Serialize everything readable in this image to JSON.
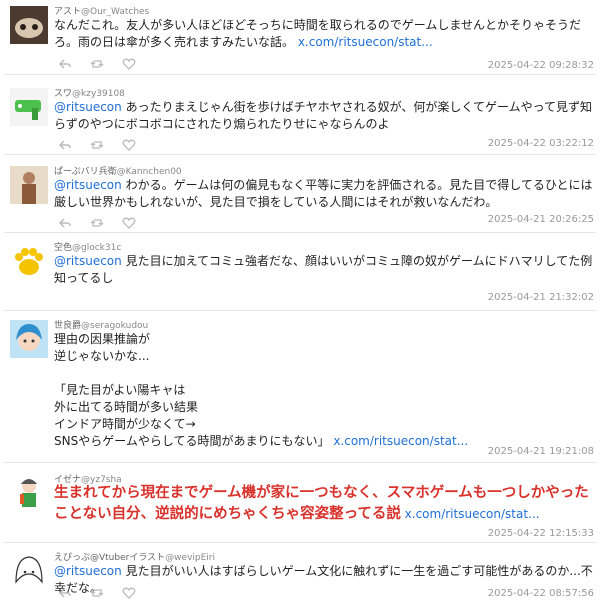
{
  "tweets": [
    {
      "name": "アスト",
      "handle": "@Our_Watches",
      "mention": "",
      "text": "なんだこれ。友人が多い人ほどほどそっちに時間を取られるのでゲームしませんとかそりゃそうだろ。雨の日は傘が多く売れますみたいな話。 ",
      "link": "x.com/ritsuecon/stat...",
      "timestamp": "2025-04-22 09:28:32"
    },
    {
      "name": "スワ",
      "handle": "@kzy39108",
      "mention": "@ritsuecon",
      "text": " あったりまえじゃん街を歩けばチヤホヤされる奴が、何が楽しくてゲームやって見ず知らずのやつにボコボコにされたり煽られたりせにゃならんのよ",
      "link": "",
      "timestamp": "2025-04-22 03:22:12"
    },
    {
      "name": "ぱーぷバリ兵衛",
      "handle": "@Kannchen00",
      "mention": "@ritsuecon",
      "text": " わかる。ゲームは何の偏見もなく平等に実力を評価される。見た目で得してるひとには厳しい世界かもしれないが、見た目で損をしている人間にはそれが救いなんだわ。",
      "link": "",
      "timestamp": "2025-04-21 20:26:25"
    },
    {
      "name": "空色",
      "handle": "@glock31c",
      "mention": "@ritsuecon",
      "text": " 見た目に加えてコミュ強者だな、顔はいいがコミュ障の奴がゲームにドハマリしてた例知ってるし",
      "link": "",
      "timestamp": "2025-04-21 21:32:02"
    },
    {
      "name": "世良爵",
      "handle": "@seragokudou",
      "mention": "",
      "text": "理由の因果推論が\n逆じゃないかな...\n\n「見た目がよい陽キャは\n外に出てる時間が多い結果\nインドア時間が少なくて→\nSNSやらゲームやらしてる時間があまりにもない」 ",
      "link": "x.com/ritsuecon/stat...",
      "timestamp": "2025-04-21 19:21:08"
    },
    {
      "name": "イゼナ",
      "handle": "@yz7sha",
      "mention": "",
      "text": "生まれてから現在までゲーム機が家に一つもなく、スマホゲームも一つしかやったことない自分、逆説的にめちゃくちゃ容姿整ってる説",
      "link": " x.com/ritsuecon/stat...",
      "timestamp": "2025-04-22 12:15:33"
    },
    {
      "name": "えぴっぷ@Vtuberイラスト",
      "handle": "@wevipEiri",
      "mention": "@ritsuecon",
      "text": " 見た目がいい人はすばらしいゲーム文化に触れずに一生を過ごす可能性があるのか...不幸だな。",
      "link": "",
      "timestamp": "2025-04-22 08:57:56"
    }
  ],
  "colors": {
    "mention": "#1f6fd6",
    "link": "#1f6fd6",
    "emphasis": "#d9312b",
    "timestamp": "#999999"
  },
  "icons": [
    "reply-icon",
    "retweet-icon",
    "like-icon"
  ]
}
